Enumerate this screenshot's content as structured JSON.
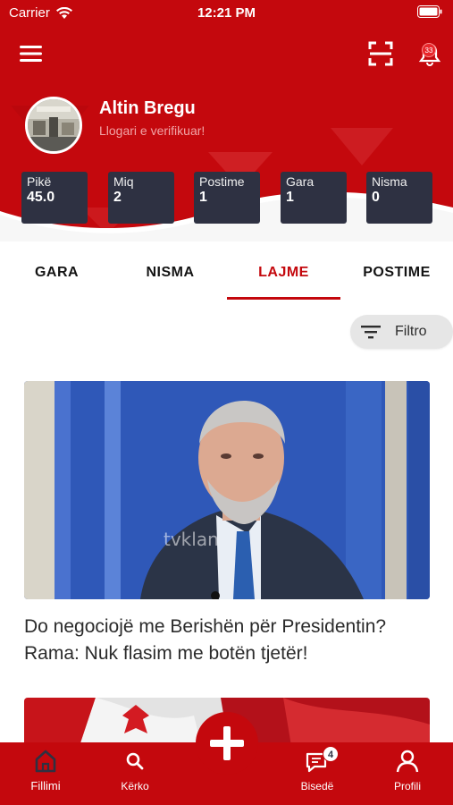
{
  "status_bar": {
    "carrier": "Carrier",
    "time": "12:21 PM"
  },
  "header": {
    "menu_icon": "hamburger-icon",
    "scan_icon": "qr-scan-icon",
    "bell_icon": "bell-icon",
    "notification_count": "33"
  },
  "profile": {
    "name": "Altin Bregu",
    "subtitle": "Llogari e verifikuar!"
  },
  "stats": [
    {
      "label": "Pikë",
      "value": "45.0"
    },
    {
      "label": "Miq",
      "value": "2"
    },
    {
      "label": "Postime",
      "value": "1"
    },
    {
      "label": "Gara",
      "value": "1"
    },
    {
      "label": "Nisma",
      "value": "0"
    }
  ],
  "tabs": [
    {
      "label": "GARA",
      "active": false
    },
    {
      "label": "NISMA",
      "active": false
    },
    {
      "label": "LAJME",
      "active": true
    },
    {
      "label": "POSTIME",
      "active": false
    }
  ],
  "filter": {
    "label": "Filtro",
    "icon": "filter-icon"
  },
  "news": [
    {
      "title": "Do negociojë me Berishën për Presidentin? Rama: Nuk flasim me botën tjetër!",
      "image_caption": "tvklan"
    }
  ],
  "bottom_nav": {
    "items": [
      {
        "label": "Fillimi",
        "icon": "home-icon",
        "active": true
      },
      {
        "label": "Kërko",
        "icon": "search-icon",
        "active": false
      },
      {
        "label": "Bisedë",
        "icon": "chat-icon",
        "active": false,
        "badge": "4"
      },
      {
        "label": "Profili",
        "icon": "user-icon",
        "active": false
      }
    ],
    "fab_icon": "plus-icon"
  },
  "colors": {
    "primary": "#c4080d",
    "card_dark": "#2e3142",
    "filter_bg": "#e6e6e6"
  }
}
